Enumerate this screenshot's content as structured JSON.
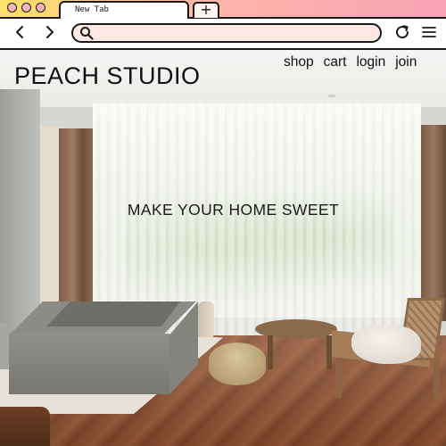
{
  "browser": {
    "tab_title": "New Tab",
    "new_tab_label": "+",
    "address_bar": {
      "value": "",
      "placeholder": ""
    },
    "icons": {
      "back": "chevron-left-icon",
      "forward": "chevron-right-icon",
      "search": "search-icon",
      "reload": "reload-icon",
      "menu": "hamburger-menu-icon"
    },
    "colors": {
      "tabbar_gradient_start": "#ffe067",
      "tabbar_gradient_end": "#f7a2b6",
      "window_dot": "#f6b3b8",
      "address_bar_fill": "#ffe9e4",
      "outline": "#1a1a1a"
    }
  },
  "site": {
    "brand": "PEACH STUDIO",
    "nav": {
      "shop": "shop",
      "cart": "cart",
      "login": "login",
      "join": "join"
    },
    "hero": {
      "tagline": "MAKE YOUR HOME SWEET",
      "image": "interior-photo-living-room-with-stone-bathtub"
    }
  }
}
